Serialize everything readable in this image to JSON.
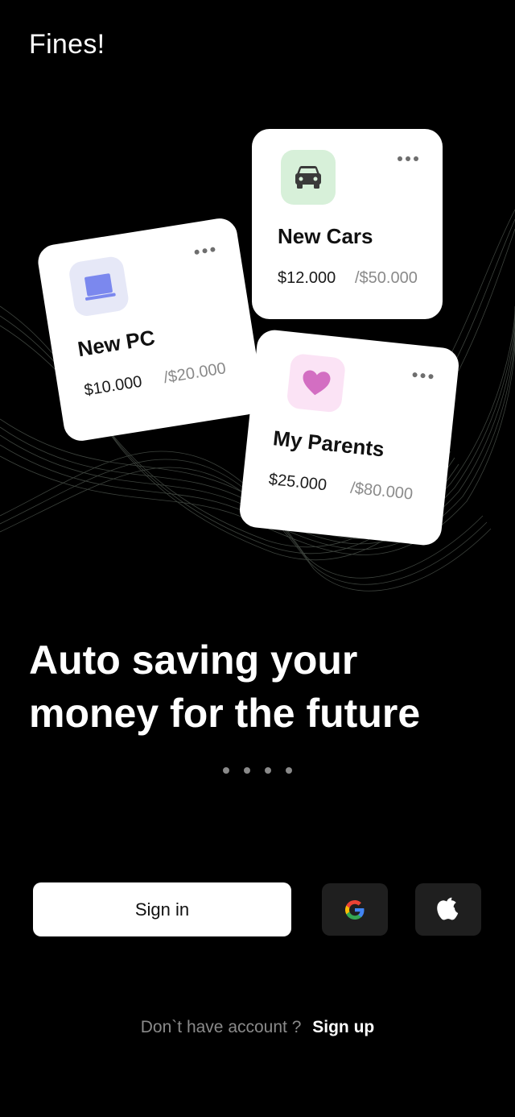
{
  "app": {
    "logo": "Fines!"
  },
  "cards": [
    {
      "title": "New Cars",
      "amount": "$12.000",
      "goal": "/$50.000",
      "icon": "car-icon",
      "icon_bg": "#d7f0d9",
      "icon_color": "#3a3a3a"
    },
    {
      "title": "New PC",
      "amount": "$10.000",
      "goal": "/$20.000",
      "icon": "laptop-icon",
      "icon_bg": "#e6e8f7",
      "icon_color": "#7b88ee"
    },
    {
      "title": "My Parents",
      "amount": "$25.000",
      "goal": "/$80.000",
      "icon": "heart-icon",
      "icon_bg": "#fbe3f5",
      "icon_color": "#d36ec2"
    }
  ],
  "hero": {
    "line1": "Auto saving your",
    "line2": "money for the future"
  },
  "pagination": {
    "count": 4,
    "active_index": 0
  },
  "actions": {
    "signin_label": "Sign in",
    "google_icon": "google-icon",
    "apple_icon": "apple-icon"
  },
  "footer": {
    "question": "Don`t have account ?",
    "signup_label": "Sign up"
  }
}
